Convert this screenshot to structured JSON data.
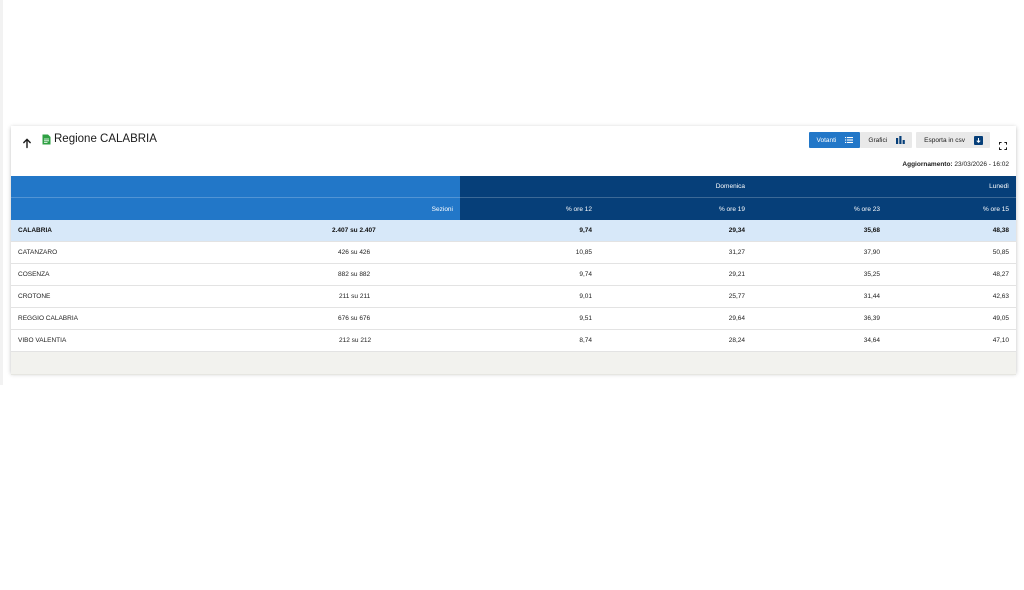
{
  "header": {
    "title": "Regione CALABRIA",
    "buttons": {
      "votanti": "Votanti",
      "grafici": "Grafici",
      "csv": "Esporta in csv"
    },
    "updated_label": "Aggiornamento:",
    "updated_value": "23/03/2026 - 16:02"
  },
  "colors": {
    "accent": "#2277c8",
    "dark": "#063f79",
    "total_row": "#d7e8f9",
    "doc_icon": "#2ea043"
  },
  "table": {
    "group_headers": {
      "domenica": "Domenica",
      "lunedi": "Lunedì"
    },
    "columns": [
      "Sezioni",
      "% ore 12",
      "% ore 19",
      "% ore 23",
      "% ore 15"
    ],
    "rows": [
      {
        "name": "CALABRIA",
        "sezioni": "2.407 su 2.407",
        "ore12": "9,74",
        "ore19": "29,34",
        "ore23": "35,68",
        "ore15": "48,38"
      },
      {
        "name": "CATANZARO",
        "sezioni": "426 su 426",
        "ore12": "10,85",
        "ore19": "31,27",
        "ore23": "37,90",
        "ore15": "50,85"
      },
      {
        "name": "COSENZA",
        "sezioni": "882 su 882",
        "ore12": "9,74",
        "ore19": "29,21",
        "ore23": "35,25",
        "ore15": "48,27"
      },
      {
        "name": "CROTONE",
        "sezioni": "211 su 211",
        "ore12": "9,01",
        "ore19": "25,77",
        "ore23": "31,44",
        "ore15": "42,63"
      },
      {
        "name": "REGGIO CALABRIA",
        "sezioni": "676 su 676",
        "ore12": "9,51",
        "ore19": "29,64",
        "ore23": "36,39",
        "ore15": "49,05"
      },
      {
        "name": "VIBO VALENTIA",
        "sezioni": "212 su 212",
        "ore12": "8,74",
        "ore19": "28,24",
        "ore23": "34,64",
        "ore15": "47,10"
      }
    ]
  }
}
